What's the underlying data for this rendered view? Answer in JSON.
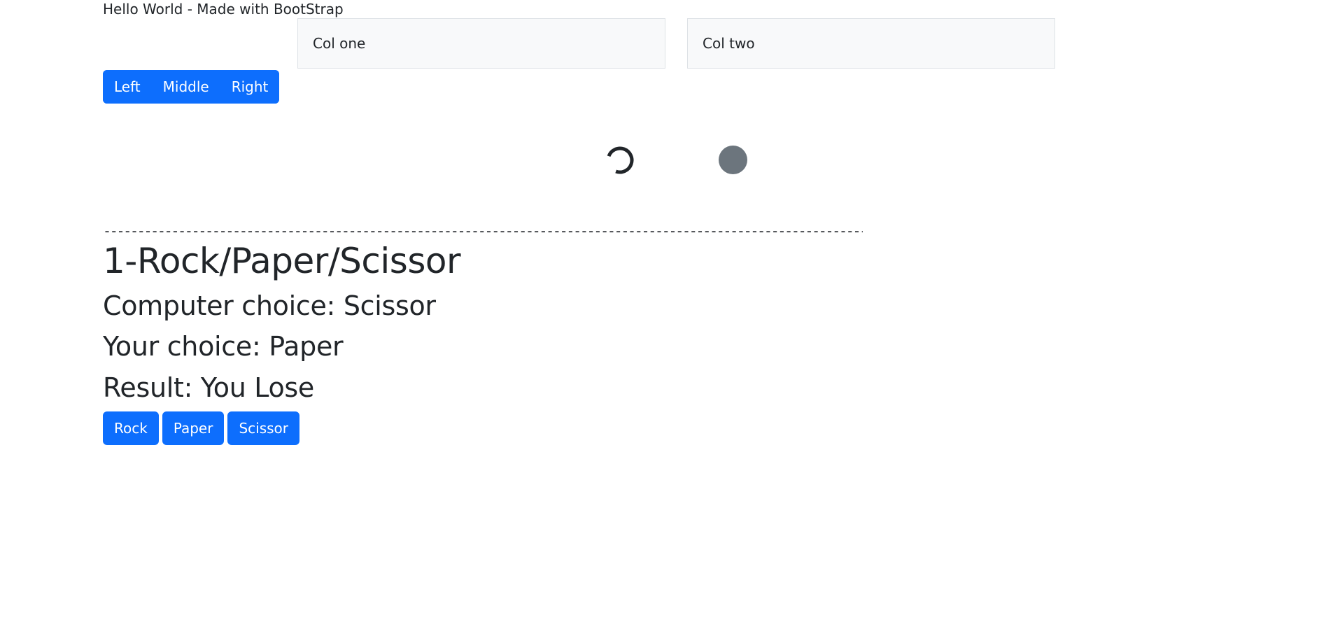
{
  "header": {
    "text": "Hello World - Made with BootStrap"
  },
  "columns": [
    {
      "label": "Col one"
    },
    {
      "label": "Col two"
    }
  ],
  "button_group": [
    {
      "label": "Left"
    },
    {
      "label": "Middle"
    },
    {
      "label": "Right"
    }
  ],
  "loaders": {
    "spinner_icon": "border-spinner-icon",
    "grow_icon": "grow-spinner-icon",
    "grow_color": "#6c757d"
  },
  "divider": {
    "text": "---------------------------------------------------------------------------------------------------------------------------------------------------------"
  },
  "game": {
    "title": "1-Rock/Paper/Scissor",
    "computer_choice": "Computer choice: Scissor",
    "your_choice": "Your choice: Paper",
    "result": "Result: You Lose",
    "buttons": [
      {
        "label": "Rock"
      },
      {
        "label": "Paper"
      },
      {
        "label": "Scissor"
      }
    ]
  },
  "colors": {
    "primary": "#0d6efd",
    "text": "#212529",
    "light_bg": "#f8f9fa"
  }
}
